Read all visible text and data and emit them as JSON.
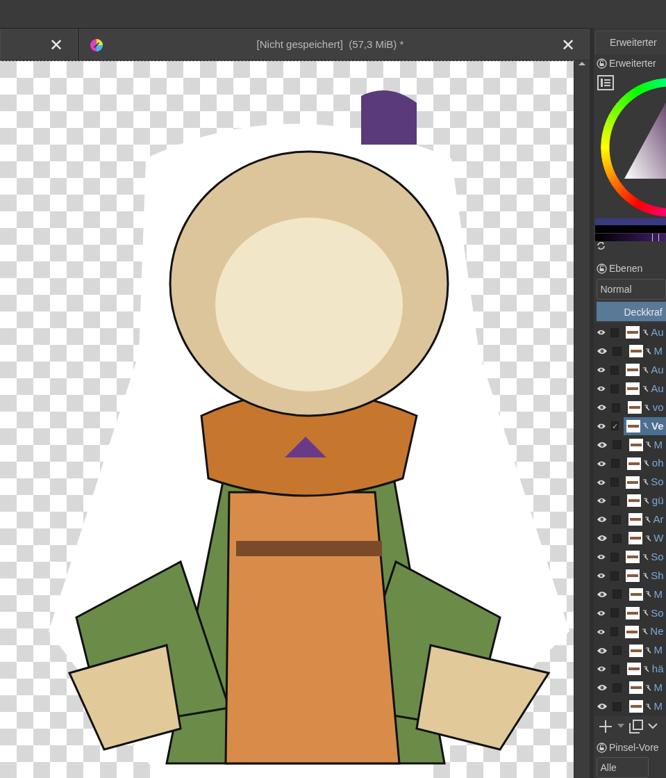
{
  "document_tabs": [
    {
      "close": "✕"
    },
    {
      "title": "[Nicht gespeichert]  (57,3 MiB) *",
      "close": "✕"
    }
  ],
  "color_docker": {
    "tab": "Erweiterter",
    "title": "Erweiterter",
    "color_slider": {
      "level": 0.85
    }
  },
  "layers_docker": {
    "title": "Ebenen",
    "blend_mode": "Normal",
    "opacity": {
      "label": "Deckkraf",
      "level": 1
    },
    "check_mark": "✓",
    "layers": [
      {
        "name": "Au",
        "selected": false
      },
      {
        "name": "M",
        "selected": false
      },
      {
        "name": "Au",
        "selected": false
      },
      {
        "name": "Au",
        "selected": false
      },
      {
        "name": "vo",
        "selected": false
      },
      {
        "name": "Ve",
        "selected": true
      },
      {
        "name": "M",
        "selected": false
      },
      {
        "name": "oh",
        "selected": false
      },
      {
        "name": "So",
        "selected": false
      },
      {
        "name": "gü",
        "selected": false
      },
      {
        "name": "Ar",
        "selected": false
      },
      {
        "name": "W",
        "selected": false
      },
      {
        "name": "So",
        "selected": false
      },
      {
        "name": "Sh",
        "selected": false
      },
      {
        "name": "M",
        "selected": false
      },
      {
        "name": "So",
        "selected": false
      },
      {
        "name": "Ne",
        "selected": false
      },
      {
        "name": "M",
        "selected": false
      },
      {
        "name": "hä",
        "selected": false
      },
      {
        "name": "M",
        "selected": false
      },
      {
        "name": "M",
        "selected": false
      }
    ]
  },
  "brush_presets": {
    "title": "Pinsel-Vore",
    "filter": "Alle"
  }
}
